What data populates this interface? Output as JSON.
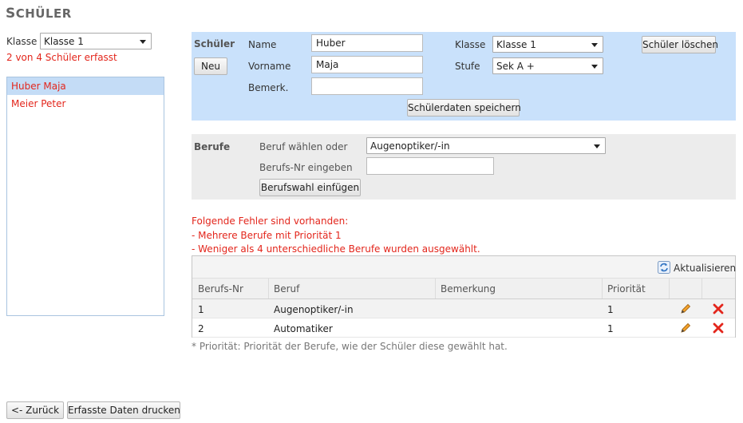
{
  "page": {
    "title_first": "S",
    "title_rest": "CHÜLER"
  },
  "left": {
    "klasse_label": "Klasse",
    "klasse_value": "Klasse 1",
    "count_text": "2 von 4 Schüler erfasst",
    "students": [
      "Huber Maja",
      "Meier Peter"
    ]
  },
  "schueler_panel": {
    "heading": "Schüler",
    "new_button": "Neu",
    "name_label": "Name",
    "name_value": "Huber",
    "vorname_label": "Vorname",
    "vorname_value": "Maja",
    "bemerk_label": "Bemerk.",
    "bemerk_value": "",
    "klasse_label": "Klasse",
    "klasse_value": "Klasse 1",
    "stufe_label": "Stufe",
    "stufe_value": "Sek A +",
    "delete_button": "Schüler löschen",
    "save_button": "Schülerdaten speichern"
  },
  "berufe_panel": {
    "heading": "Berufe",
    "select_label": "Beruf  wählen oder",
    "select_value": "Augenoptiker/-in",
    "nr_label": "Berufs-Nr  eingeben",
    "nr_value": "",
    "insert_button": "Berufswahl einfügen"
  },
  "errors": {
    "title": "Folgende Fehler sind vorhanden:",
    "items": [
      "- Mehrere Berufe mit Priorität 1",
      "- Weniger als 4 unterschiedliche Berufe wurden ausgewählt."
    ]
  },
  "grid": {
    "refresh_label": "Aktualisieren",
    "columns": [
      "Berufs-Nr",
      "Beruf",
      "Bemerkung",
      "Priorität"
    ],
    "rows": [
      {
        "nr": "1",
        "beruf": "Augenoptiker/-in",
        "bemerkung": "",
        "prioritaet": "1"
      },
      {
        "nr": "2",
        "beruf": "Automatiker",
        "bemerkung": "",
        "prioritaet": "1"
      }
    ],
    "footnote": "* Priorität: Priorität der Berufe, wie der Schüler diese gewählt hat."
  },
  "footer": {
    "back_button": "<- Zurück",
    "print_button": "Erfasste Daten drucken"
  },
  "colors": {
    "accent_red": "#e3261c",
    "panel_blue": "#c9e1fb",
    "panel_gray": "#ececec",
    "selected_row": "#c4dcf6"
  },
  "icons": {
    "refresh": "refresh-icon",
    "edit": "pencil-icon",
    "delete": "delete-x-icon",
    "dropdown": "chevron-down-icon"
  }
}
